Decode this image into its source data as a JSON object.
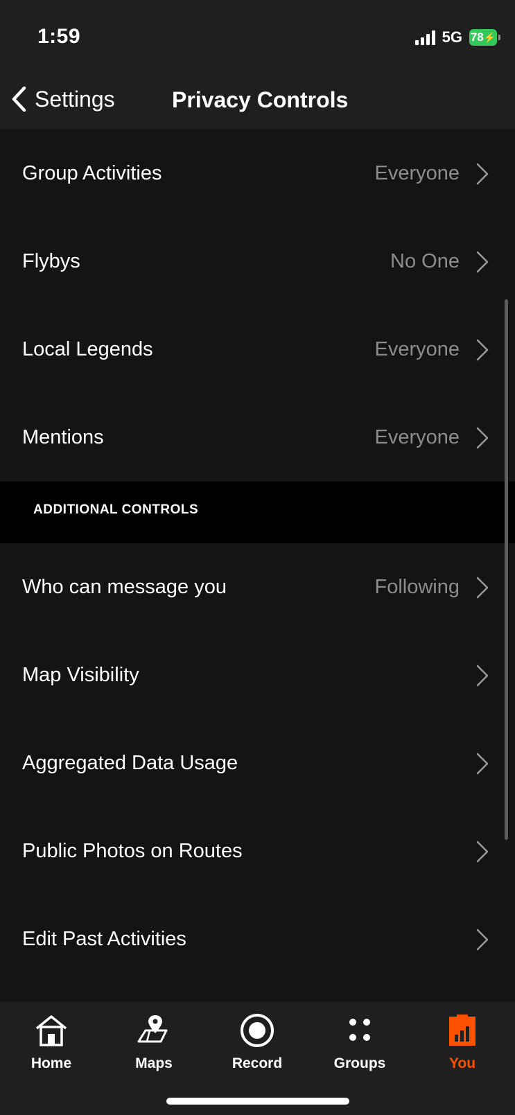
{
  "status": {
    "time": "1:59",
    "network": "5G",
    "battery": "78"
  },
  "nav": {
    "back_label": "Settings",
    "title": "Privacy Controls"
  },
  "rows_top": [
    {
      "label": "Group Activities",
      "value": "Everyone"
    },
    {
      "label": "Flybys",
      "value": "No One"
    },
    {
      "label": "Local Legends",
      "value": "Everyone"
    },
    {
      "label": "Mentions",
      "value": "Everyone"
    }
  ],
  "section": {
    "title": "ADDITIONAL CONTROLS"
  },
  "rows_additional": [
    {
      "label": "Who can message you",
      "value": "Following"
    },
    {
      "label": "Map Visibility",
      "value": ""
    },
    {
      "label": "Aggregated Data Usage",
      "value": ""
    },
    {
      "label": "Public Photos on Routes",
      "value": ""
    },
    {
      "label": "Edit Past Activities",
      "value": ""
    }
  ],
  "tabs": [
    {
      "label": "Home",
      "icon": "home-icon"
    },
    {
      "label": "Maps",
      "icon": "map-icon"
    },
    {
      "label": "Record",
      "icon": "record-icon"
    },
    {
      "label": "Groups",
      "icon": "groups-icon"
    },
    {
      "label": "You",
      "icon": "you-icon",
      "active": true
    }
  ],
  "colors": {
    "accent": "#fc5200",
    "background": "#141414",
    "bar": "#1f1f1f",
    "secondary_text": "#8d8d8d"
  }
}
